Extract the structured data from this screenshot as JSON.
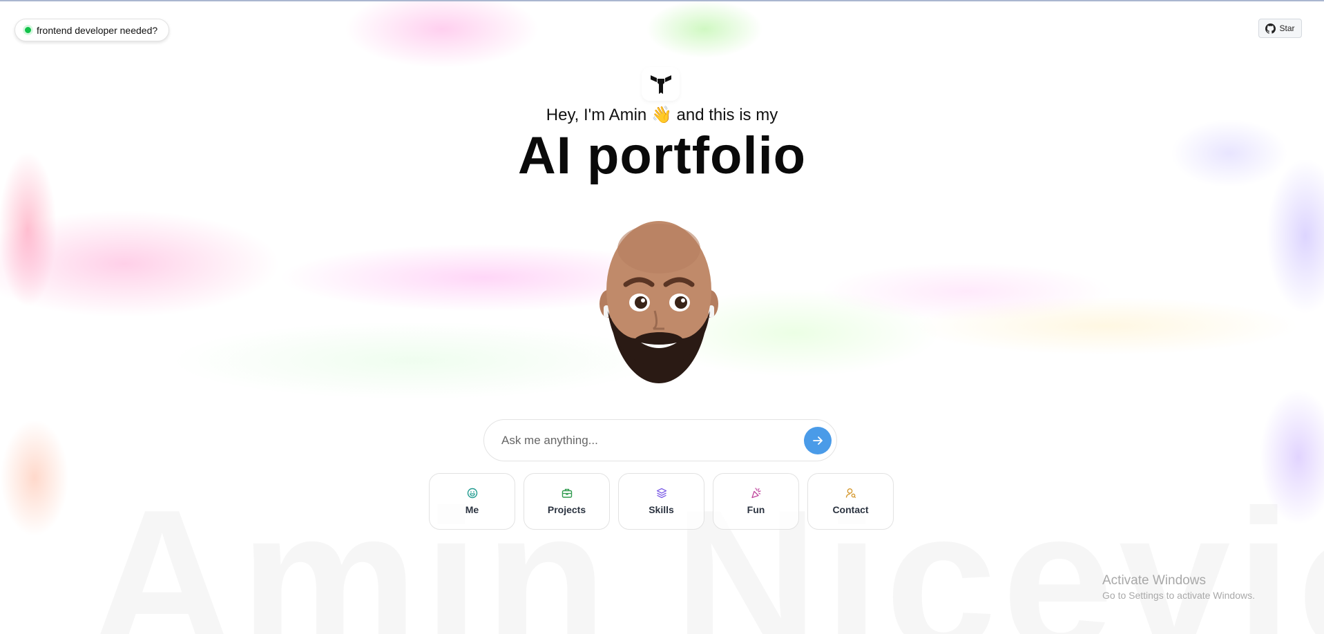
{
  "badge": {
    "label": "frontend developer needed?",
    "status_color": "#12c24a"
  },
  "github": {
    "label": "Star",
    "icon": "github-icon"
  },
  "hero": {
    "greeting": "Hey, I'm Amin",
    "emoji": "👋",
    "greeting_suffix": "and this is my",
    "title": "AI portfolio"
  },
  "watermark": "Amin Nicević",
  "chat": {
    "placeholder": "Ask me anything...",
    "send_icon": "arrow-right-icon",
    "accent": "#4a9be8"
  },
  "tiles": [
    {
      "label": "Me",
      "icon": "smile-icon",
      "color": "#1f9a8f"
    },
    {
      "label": "Projects",
      "icon": "briefcase-icon",
      "color": "#2e9a4d"
    },
    {
      "label": "Skills",
      "icon": "layers-icon",
      "color": "#7c5ce6"
    },
    {
      "label": "Fun",
      "icon": "party-popper-icon",
      "color": "#c0479e"
    },
    {
      "label": "Contact",
      "icon": "user-search-icon",
      "color": "#d4962a"
    }
  ],
  "os_notice": {
    "title": "Activate Windows",
    "subtitle": "Go to Settings to activate Windows."
  }
}
